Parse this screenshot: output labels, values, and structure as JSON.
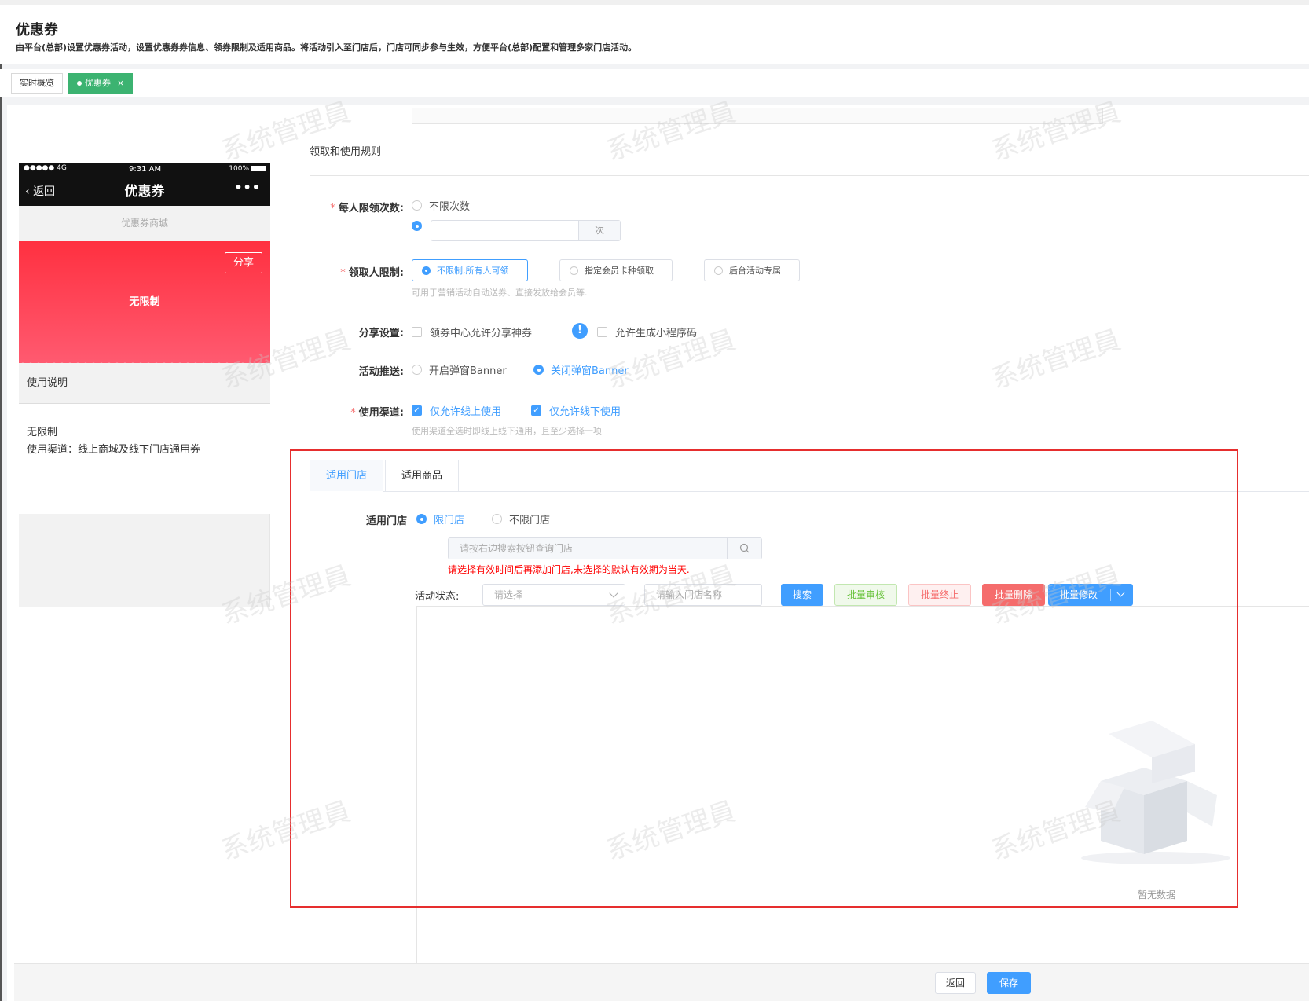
{
  "header": {
    "title": "优惠券",
    "description": "由平台(总部)设置优惠券活动，设置优惠券券信息、领券限制及适用商品。将活动引入至门店后，门店可同步参与生效，方便平台(总部)配置和管理多家门店活动。"
  },
  "tabs": [
    {
      "label": "实时概览"
    },
    {
      "label": "优惠券",
      "close": "×"
    }
  ],
  "phone": {
    "signal": "●●●●● 4G",
    "time": "9:31 AM",
    "battery": "100%",
    "back": "返回",
    "title": "优惠券",
    "more": "•••",
    "subtitle": "优惠券商城",
    "share": "分享",
    "coupon_label": "无限制",
    "usage_title": "使用说明",
    "info_line1": "无限制",
    "info_line2": "使用渠道：线上商城及线下门店通用券"
  },
  "form": {
    "section_title": "领取和使用规则",
    "per_person_limit": {
      "label": "每人限领次数:",
      "opt_unlimited": "不限次数",
      "suffix": "次"
    },
    "receiver_limit": {
      "label": "领取人限制:",
      "options": [
        "不限制,所有人可领",
        "指定会员卡种领取",
        "后台活动专属"
      ],
      "hint": "可用于营销活动自动送券、直接发放给会员等."
    },
    "share_settings": {
      "label": "分享设置:",
      "opt1": "领券中心允许分享神券",
      "info_icon": "!",
      "opt2": "允许生成小程序码"
    },
    "activity_push": {
      "label": "活动推送:",
      "opt1": "开启弹窗Banner",
      "opt2": "关闭弹窗Banner"
    },
    "channels": {
      "label": "使用渠道:",
      "opt1": "仅允许线上使用",
      "opt2": "仅允许线下使用",
      "hint": "使用渠道全选时即线上线下通用，且至少选择一项"
    }
  },
  "panel": {
    "tabs": [
      "适用门店",
      "适用商品"
    ],
    "store_label": "适用门店",
    "opt_limited": "限门店",
    "opt_unlimited": "不限门店",
    "search_placeholder": "请按右边搜索按钮查询门店",
    "warning": "请选择有效时间后再添加门店,未选择的默认有效期为当天.",
    "filter_label": "活动状态:",
    "select_placeholder": "请选择",
    "name_placeholder": "请输入门店名称",
    "btn_search": "搜索",
    "btn_audit": "批量审核",
    "btn_stop": "批量终止",
    "btn_delete": "批量删除",
    "btn_edit": "批量修改",
    "empty": "暂无数据"
  },
  "footer": {
    "back": "返回",
    "save": "保存"
  },
  "watermark": "系统管理員",
  "colors": {
    "primary": "#409eff",
    "tab_active": "#3cb371",
    "coupon": "#ff3040",
    "highlight_box": "#e62e2e"
  }
}
